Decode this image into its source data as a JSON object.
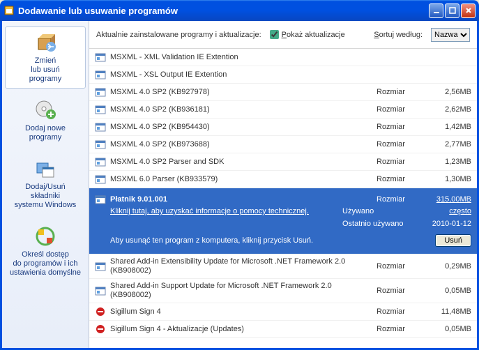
{
  "window": {
    "title": "Dodawanie lub usuwanie programów"
  },
  "sidebar": {
    "items": [
      {
        "label": "Zmień\nlub usuń\nprogramy"
      },
      {
        "label": "Dodaj nowe\nprogramy"
      },
      {
        "label": "Dodaj/Usuń\nskładniki\nsystemu Windows"
      },
      {
        "label": "Określ dostęp\ndo programów i ich\nustawienia domyślne"
      }
    ]
  },
  "toolbar": {
    "installed_label": "Aktualnie zainstalowane programy i aktualizacje:",
    "show_updates_label": "Pokaż aktualizacje",
    "sort_label": "Sortuj według:",
    "sort_value": "Nazwa"
  },
  "labels": {
    "size": "Rozmiar",
    "used": "Używano",
    "last_used": "Ostatnio używano"
  },
  "selected": {
    "name": "Płatnik 9.01.001",
    "size": "315,00MB",
    "support_link": "Kliknij tutaj, aby uzyskać informacje o pomocy technicznej.",
    "used_value": "często",
    "last_used_value": "2010-01-12",
    "remove_text": "Aby usunąć ten program z komputera, kliknij przycisk Usuń.",
    "remove_button": "Usuń"
  },
  "programs": [
    {
      "name": "MSXML - XML Validation IE Extention",
      "size": ""
    },
    {
      "name": "MSXML - XSL Output IE Extention",
      "size": ""
    },
    {
      "name": "MSXML 4.0 SP2 (KB927978)",
      "size": "2,56MB"
    },
    {
      "name": "MSXML 4.0 SP2 (KB936181)",
      "size": "2,62MB"
    },
    {
      "name": "MSXML 4.0 SP2 (KB954430)",
      "size": "1,42MB"
    },
    {
      "name": "MSXML 4.0 SP2 (KB973688)",
      "size": "2,77MB"
    },
    {
      "name": "MSXML 4.0 SP2 Parser and SDK",
      "size": "1,23MB"
    },
    {
      "name": "MSXML 6.0 Parser (KB933579)",
      "size": "1,30MB"
    }
  ],
  "programs_after": [
    {
      "name": "Shared Add-in Extensibility Update for Microsoft .NET Framework 2.0 (KB908002)",
      "size": "0,29MB"
    },
    {
      "name": "Shared Add-in Support Update for Microsoft .NET Framework 2.0 (KB908002)",
      "size": "0,05MB"
    },
    {
      "name": "Sigillum Sign 4",
      "size": "11,48MB"
    },
    {
      "name": "Sigillum Sign 4 - Aktualizacje (Updates)",
      "size": "0,05MB"
    }
  ]
}
